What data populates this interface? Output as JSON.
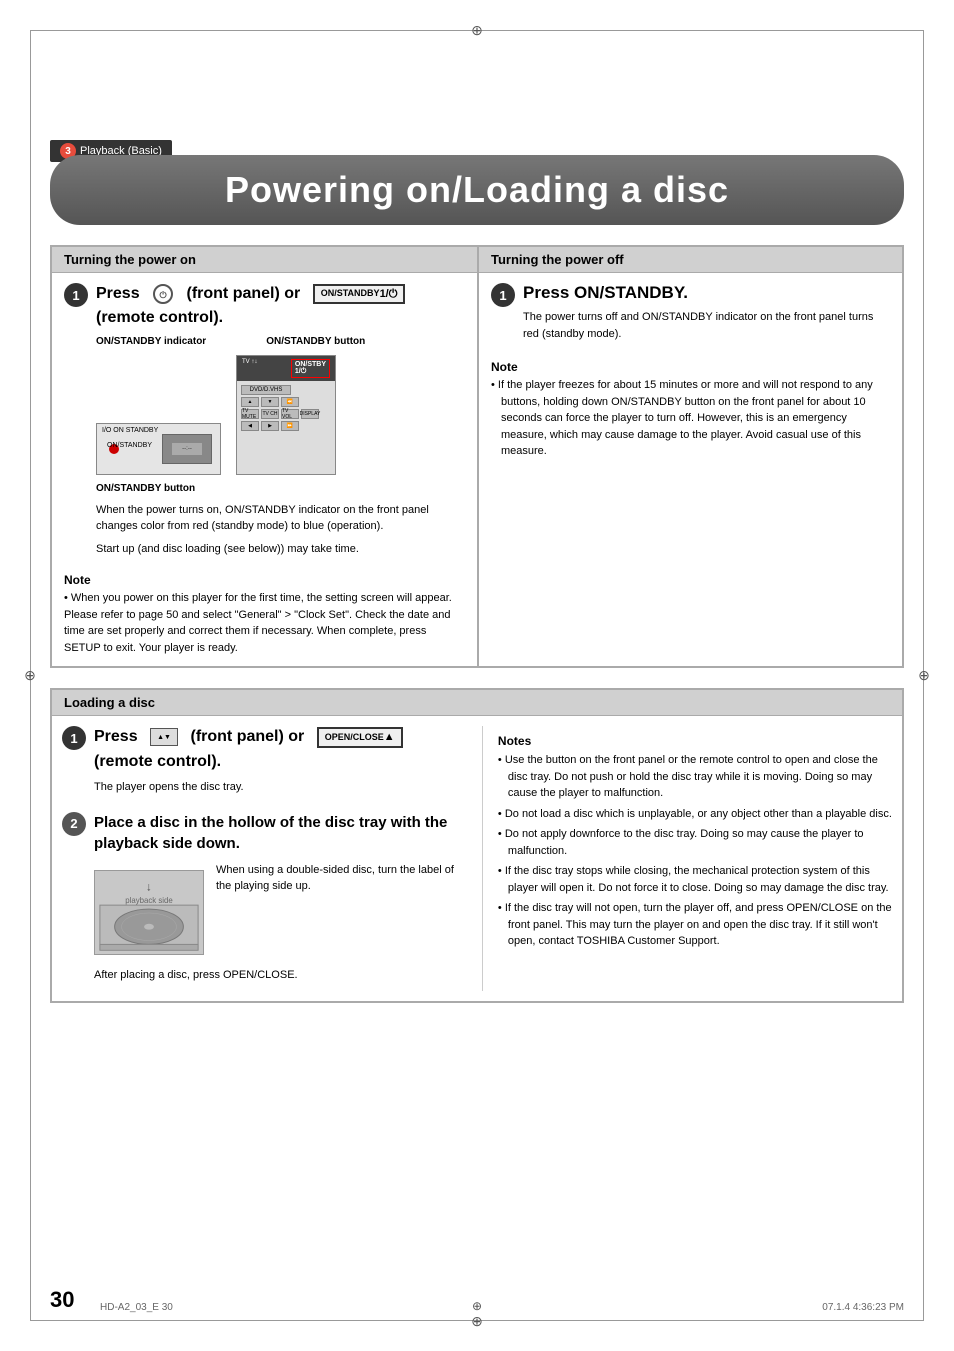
{
  "page": {
    "number": "30",
    "footer_left": "HD-A2_03_E  30",
    "footer_right": "07.1.4  4:36:23 PM",
    "reg_mark": "⊕"
  },
  "chapter": {
    "num": "3",
    "label": "Playback (Basic)"
  },
  "title": "Powering on/Loading a disc",
  "sections": {
    "turn_on": {
      "header": "Turning the power on",
      "step1": {
        "press_label": "Press",
        "front_panel_label": "(front panel) or",
        "remote_label": "(remote control).",
        "on_standby_indicator_label": "ON/STANDBY indicator",
        "on_standby_button_label": "ON/STANDBY button",
        "on_standby_button_below": "ON/STANDBY button",
        "body1": "When the power turns on, ON/STANDBY indicator on the front panel changes color from red (standby mode) to blue (operation).",
        "body2": "Start up (and disc loading (see below)) may take time."
      },
      "note_label": "Note",
      "note_text": "When you power on this player for the first time, the setting screen will appear. Please refer to  page 50 and select \"General\" > \"Clock Set\". Check the date and time are set properly and correct them if necessary. When complete, press SETUP to exit. Your player is ready."
    },
    "turn_off": {
      "header": "Turning the power off",
      "step1": {
        "heading": "Press ON/STANDBY.",
        "body": "The power turns off and ON/STANDBY indicator on the front panel turns red (standby mode)."
      },
      "note_label": "Note",
      "note_bullets": [
        "If the player freezes for about 15 minutes or more and will not respond to any buttons, holding down ON/STANDBY button on the front panel for about 10 seconds can force the player to turn off. However, this is an emergency measure, which may cause damage to the player. Avoid casual use of this measure."
      ]
    },
    "loading": {
      "header": "Loading a disc",
      "step1": {
        "press_label": "Press",
        "front_label": "(front panel) or",
        "remote_label": "(remote control).",
        "body": "The player opens the disc tray."
      },
      "step2": {
        "heading": "Place a disc in the hollow of the disc tray with the playback side down.",
        "disc_note": "When using a double-sided disc, turn the label of the playing side up.",
        "after": "After placing a disc, press OPEN/CLOSE."
      },
      "notes_label": "Notes",
      "notes_bullets": [
        "Use the button on the front panel or the remote control to open and close the disc tray. Do not push or hold the disc tray while it is moving. Doing so may cause the player to malfunction.",
        "Do not load a disc which is unplayable, or any object other than a playable disc.",
        "Do not apply downforce to the disc tray. Doing so may cause the player to malfunction.",
        "If the disc tray stops while closing, the mechanical protection system of this player will open it. Do not force it to close. Doing so may damage the disc tray.",
        "If the disc tray will not open, turn the player off, and press OPEN/CLOSE on the front panel. This may turn the player on and open the disc tray. If it still won't open, contact TOSHIBA Customer Support."
      ]
    }
  }
}
